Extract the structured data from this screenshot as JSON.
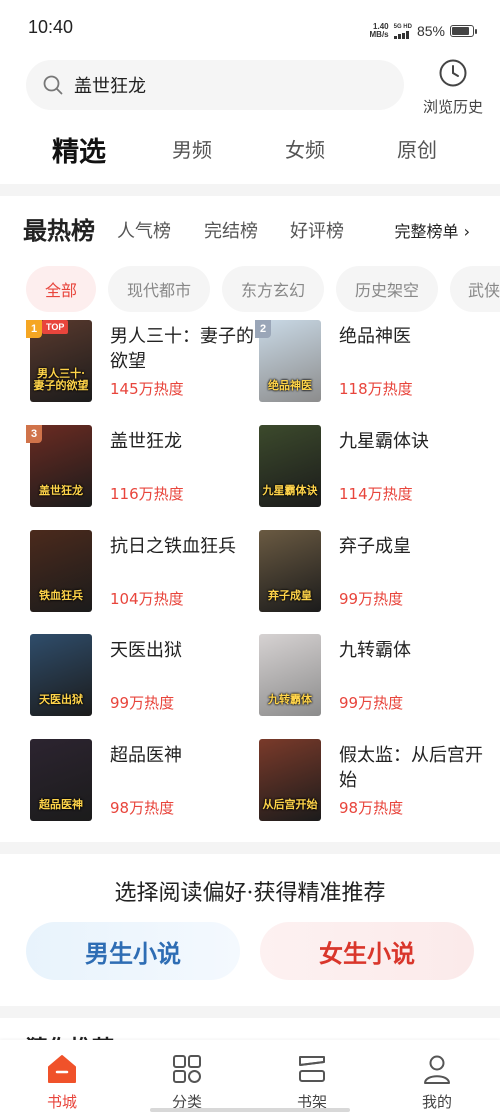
{
  "status": {
    "time": "10:40",
    "net_speed_value": "1.40",
    "net_speed_unit": "MB/s",
    "network_type": "5G HD",
    "battery_percent": "85%",
    "battery_level": 0.85
  },
  "search": {
    "query": "盖世狂龙",
    "history_label": "浏览历史"
  },
  "top_tabs": [
    "精选",
    "男频",
    "女频",
    "原创"
  ],
  "top_tabs_active": 0,
  "ranking": {
    "title": "最热榜",
    "tabs": [
      "人气榜",
      "完结榜",
      "好评榜"
    ],
    "full_list": "完整榜单 ›"
  },
  "genres": [
    "全部",
    "现代都市",
    "东方玄幻",
    "历史架空",
    "武侠"
  ],
  "genres_active": 0,
  "books": [
    {
      "rank": "1",
      "top_badge": "TOP",
      "title": "男人三十：妻子的欲望",
      "heat": "145万热度",
      "cover_text": "男人三十·妻子的欲望",
      "cover_bg": "#5a3a2e"
    },
    {
      "rank": "2",
      "title": "绝品神医",
      "heat": "118万热度",
      "cover_text": "绝品神医",
      "cover_bg": "#c9d9e6"
    },
    {
      "rank": "3",
      "title": "盖世狂龙",
      "heat": "116万热度",
      "cover_text": "盖世狂龙",
      "cover_bg": "#6b2b22"
    },
    {
      "title": "九星霸体诀",
      "heat": "114万热度",
      "cover_text": "九星霸体诀",
      "cover_bg": "#3c4a2c"
    },
    {
      "title": "抗日之铁血狂兵",
      "heat": "104万热度",
      "cover_text": "铁血狂兵",
      "cover_bg": "#4b2a1c"
    },
    {
      "title": "弃子成皇",
      "heat": "99万热度",
      "cover_text": "弃子成皇",
      "cover_bg": "#6a5a42"
    },
    {
      "title": "天医出狱",
      "heat": "99万热度",
      "cover_text": "天医出狱",
      "cover_bg": "#2f4d6b"
    },
    {
      "title": "九转霸体",
      "heat": "99万热度",
      "cover_text": "九转霸体",
      "cover_bg": "#d6d2d2"
    },
    {
      "title": "超品医神",
      "heat": "98万热度",
      "cover_text": "超品医神",
      "cover_bg": "#2c2430"
    },
    {
      "title": "假太监：从后宫开始",
      "heat": "98万热度",
      "cover_text": "从后宫开始",
      "cover_bg": "#7a3a2a"
    }
  ],
  "preference": {
    "title": "选择阅读偏好·获得精准推荐",
    "male": "男生小说",
    "female": "女生小说"
  },
  "section_peek": "猜你推荐",
  "bottom_nav": [
    {
      "label": "书城",
      "icon": "home-icon"
    },
    {
      "label": "分类",
      "icon": "category-grid-icon"
    },
    {
      "label": "书架",
      "icon": "bookshelf-icon"
    },
    {
      "label": "我的",
      "icon": "profile-icon"
    }
  ],
  "bottom_nav_active": 0,
  "colors": {
    "accent": "#e8453c",
    "male": "#2e6db4",
    "female": "#d9362b",
    "rank1": "#f5a623",
    "rank2": "#9aa6b8",
    "rank3": "#d0734a"
  }
}
